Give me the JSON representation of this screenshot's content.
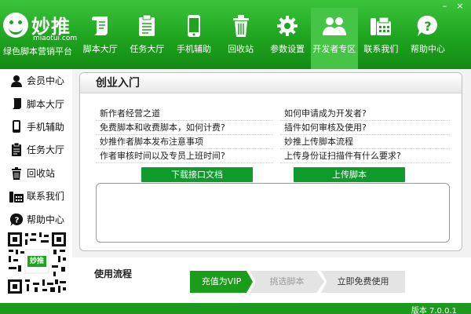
{
  "app": {
    "logo_name": "妙推",
    "logo_domain": "miaotui.com",
    "slogan": "绿色脚本营销平台",
    "window_controls": {
      "minimize": "–",
      "close": "×"
    }
  },
  "nav": {
    "items": [
      {
        "label": "脚本大厅",
        "icon": "scroll-icon"
      },
      {
        "label": "任务大厅",
        "icon": "clipboard-icon"
      },
      {
        "label": "手机辅助",
        "icon": "phone-icon"
      },
      {
        "label": "回收站",
        "icon": "trash-icon"
      },
      {
        "label": "参数设置",
        "icon": "gear-icon"
      },
      {
        "label": "开发者专区",
        "icon": "users-icon",
        "active": true
      },
      {
        "label": "联系我们",
        "icon": "telephone-icon"
      },
      {
        "label": "帮助中心",
        "icon": "help-icon"
      }
    ]
  },
  "sidebar": {
    "items": [
      {
        "label": "会员中心",
        "icon": "user-icon"
      },
      {
        "label": "脚本大厅",
        "icon": "scroll-icon"
      },
      {
        "label": "手机辅助",
        "icon": "phone-icon"
      },
      {
        "label": "任务大厅",
        "icon": "clipboard-icon"
      },
      {
        "label": "回收站",
        "icon": "trash-icon"
      },
      {
        "label": "联系我们",
        "icon": "telephone-icon"
      },
      {
        "label": "帮助中心",
        "icon": "help-icon"
      }
    ],
    "qr_label": "妙推"
  },
  "panel": {
    "title": "创业入门",
    "left_links": [
      "新作者经营之道",
      "免费脚本和收费脚本，如何计费?",
      "妙推作者脚本发布注意事项",
      "作者审核时间以及专员上班时间?"
    ],
    "right_links": [
      "如何申请成为开发者?",
      "插件如何审核及使用?",
      "妙推上传脚本流程",
      "上传身份证扫描件有什么要求?"
    ],
    "download_button": "下载接口文档",
    "upload_button": "上传脚本"
  },
  "flow": {
    "title": "使用流程",
    "steps": [
      "充值为VIP",
      "挑选脚本",
      "立即免费使用"
    ]
  },
  "status": {
    "version": "版本 7.0.0.1"
  },
  "colors": {
    "brand_green": "#1fa41f",
    "active_tab": "#45c445",
    "button_green": "#0f9a2c"
  }
}
